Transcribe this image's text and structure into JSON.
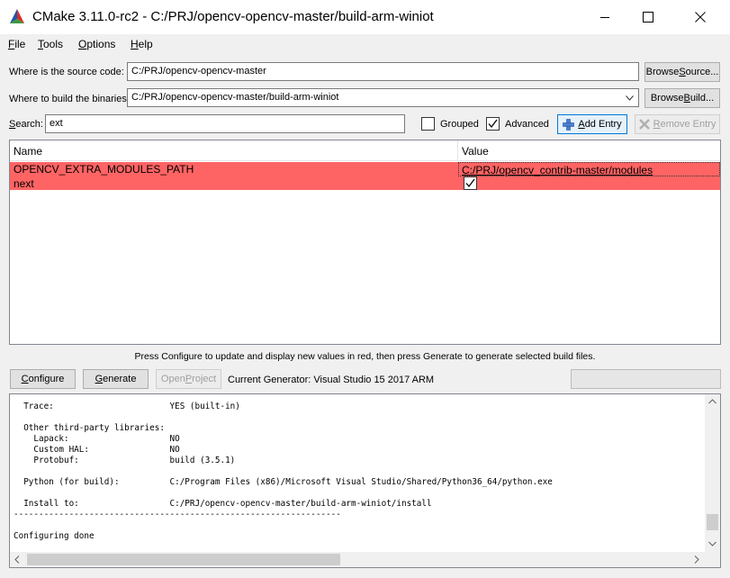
{
  "window": {
    "title": "CMake 3.11.0-rc2 - C:/PRJ/opencv-opencv-master/build-arm-winiot",
    "controls": [
      "minimize-icon",
      "maximize-icon",
      "close-icon"
    ]
  },
  "menu": {
    "file": {
      "key": "F",
      "rest": "ile"
    },
    "tools": {
      "key": "T",
      "rest": "ools"
    },
    "options": {
      "key": "O",
      "rest": "ptions"
    },
    "help": {
      "key": "H",
      "rest": "elp"
    }
  },
  "source": {
    "label": "Where is the source code:",
    "value": "C:/PRJ/opencv-opencv-master",
    "button": {
      "pre": "Browse ",
      "key": "S",
      "post": "ource..."
    }
  },
  "build": {
    "label": "Where to build the binaries:",
    "value": "C:/PRJ/opencv-opencv-master/build-arm-winiot",
    "button": {
      "pre": "Browse ",
      "key": "B",
      "post": "uild..."
    }
  },
  "search": {
    "label_key": "S",
    "label_rest": "earch:",
    "value": "ext",
    "grouped_label": "Grouped",
    "grouped_checked": false,
    "advanced_label": "Advanced",
    "advanced_checked": true,
    "add_entry": {
      "key": "A",
      "rest": "dd Entry"
    },
    "remove_entry": {
      "key": "R",
      "rest": "emove Entry"
    }
  },
  "table": {
    "columns": [
      "Name",
      "Value"
    ],
    "rows": [
      {
        "name": "OPENCV_EXTRA_MODULES_PATH",
        "value": "C:/PRJ/opencv_contrib-master/modules",
        "type": "path"
      },
      {
        "name": "next",
        "value": "",
        "checked": true,
        "type": "bool"
      }
    ],
    "highlight_color": "#ff6464"
  },
  "hint": "Press Configure to update and display new values in red, then press Generate to generate selected build files.",
  "actions": {
    "configure": {
      "key": "C",
      "rest": "onfigure"
    },
    "generate": {
      "key": "G",
      "rest": "enerate"
    },
    "open_project": {
      "pre": "Open ",
      "key": "P",
      "rest": "roject"
    },
    "generator_text": "Current Generator: Visual Studio 15 2017 ARM"
  },
  "output": {
    "lines": [
      "  Trace:                       YES (built-in)",
      "",
      "  Other third-party libraries:",
      "    Lapack:                    NO",
      "    Custom HAL:                NO",
      "    Protobuf:                  build (3.5.1)",
      "",
      "  Python (for build):          C:/Program Files (x86)/Microsoft Visual Studio/Shared/Python36_64/python.exe",
      "",
      "  Install to:                  C:/PRJ/opencv-opencv-master/build-arm-winiot/install",
      "-----------------------------------------------------------------",
      "",
      "Configuring done"
    ],
    "vertical_scroll": 0.93
  }
}
